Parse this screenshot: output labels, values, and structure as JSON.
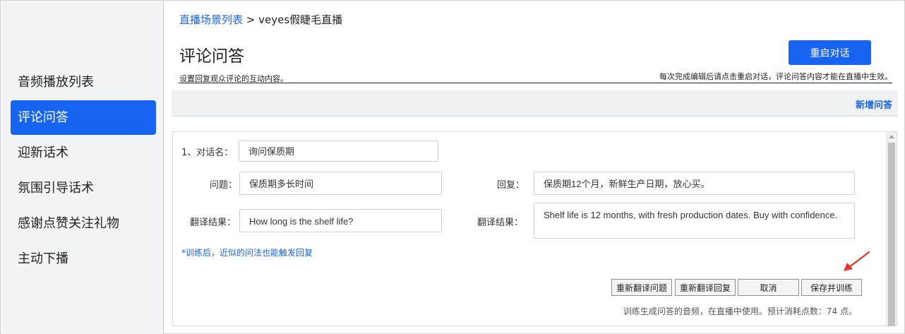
{
  "sidebar": {
    "items": [
      {
        "label": "音频播放列表"
      },
      {
        "label": "评论问答"
      },
      {
        "label": "迎新话术"
      },
      {
        "label": "氛围引导话术"
      },
      {
        "label": "感谢点赞关注礼物"
      },
      {
        "label": "主动下播"
      }
    ],
    "active_index": 1
  },
  "breadcrumb": {
    "link": "直播场景列表",
    "separator": " > ",
    "current": "veyes假睫毛直播"
  },
  "header": {
    "title": "评论问答",
    "subtitle": "设置回复观众评论的互动内容。",
    "hint": "每次完成编辑后请点击重启对话，评论问答内容才能在直播中生效。",
    "restart_label": "重启对话"
  },
  "toolbar": {
    "add_label": "新增问答"
  },
  "dialog": {
    "name_label": "1、对话名：",
    "name_value": "询问保质期",
    "question_label": "问题：",
    "question_value": "保质期多长时间",
    "reply_label": "回复：",
    "reply_value": "保质期12个月，新鲜生产日期，放心买。",
    "translation_label": "翻译结果：",
    "question_translation": "How long is the shelf life?",
    "reply_translation": "Shelf life is 12 months, with fresh production dates. Buy with confidence.",
    "note": "*训练后，近似的问法也能触发回复",
    "buttons": {
      "retranslate_question": "重新翻译问题",
      "retranslate_reply": "重新翻译回复",
      "cancel": "取消",
      "save_train": "保存并训练"
    },
    "cost_text": "训练生成问答的音频，在直播中使用。预计消耗点数：74 点。"
  },
  "colors": {
    "accent": "#1763f2",
    "annotation_arrow": "#e8322a"
  }
}
